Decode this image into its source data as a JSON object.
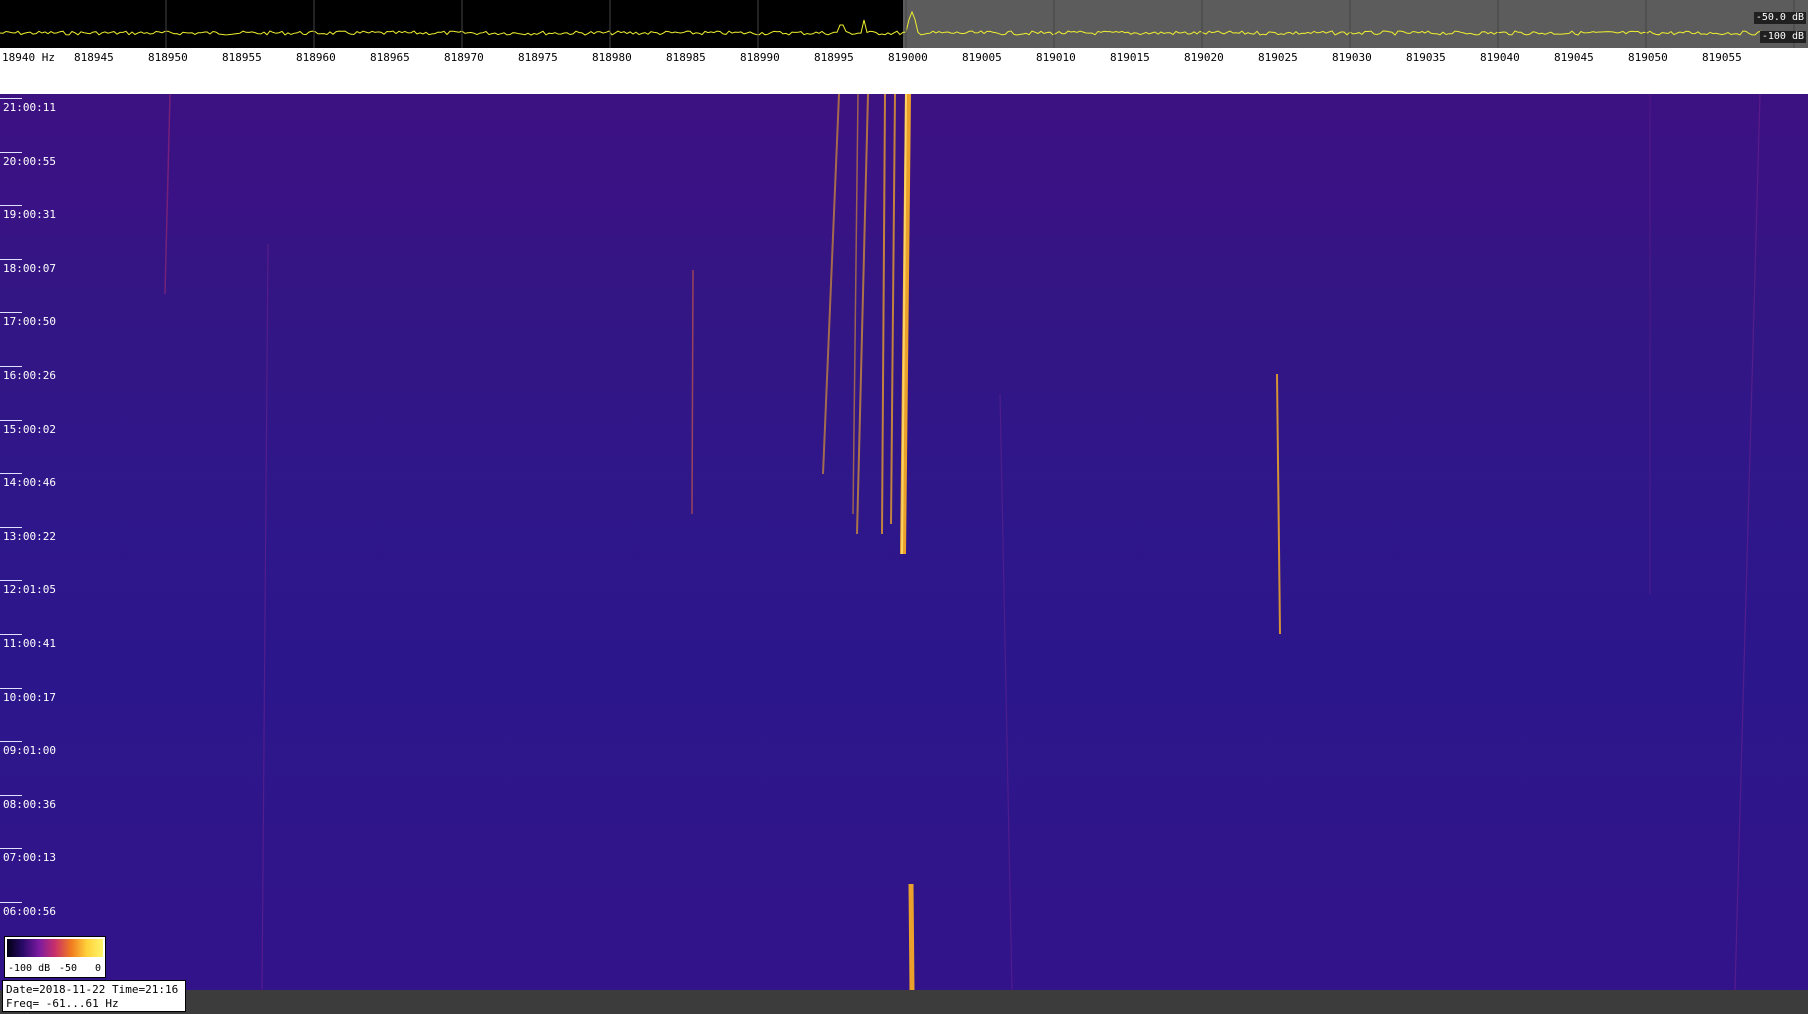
{
  "spectrum": {
    "db_top": "-50.0 dB",
    "db_bottom": "-100 dB",
    "trace_color": "#f0f030"
  },
  "frequency_scale": {
    "labels": [
      "18940 Hz",
      "818945",
      "818950",
      "818955",
      "818960",
      "818965",
      "818970",
      "818975",
      "818980",
      "818985",
      "818990",
      "818995",
      "819000",
      "819005",
      "819010",
      "819015",
      "819020",
      "819025",
      "819030",
      "819035",
      "819040",
      "819045",
      "819050",
      "819055"
    ]
  },
  "waterfall": {
    "time_labels": [
      "21:00:11",
      "20:00:55",
      "19:00:31",
      "18:00:07",
      "17:00:50",
      "16:00:26",
      "15:00:02",
      "14:00:46",
      "13:00:22",
      "12:01:05",
      "11:00:41",
      "10:00:17",
      "09:01:00",
      "08:00:36",
      "07:00:13",
      "06:00:56"
    ],
    "signal_color": "#ffb020"
  },
  "legend": {
    "min": "-100 dB",
    "mid": "-50",
    "max": "0"
  },
  "info": {
    "date_line": "Date=2018-11-22 Time=21:16",
    "freq_line": "Freq= -61...61 Hz"
  }
}
